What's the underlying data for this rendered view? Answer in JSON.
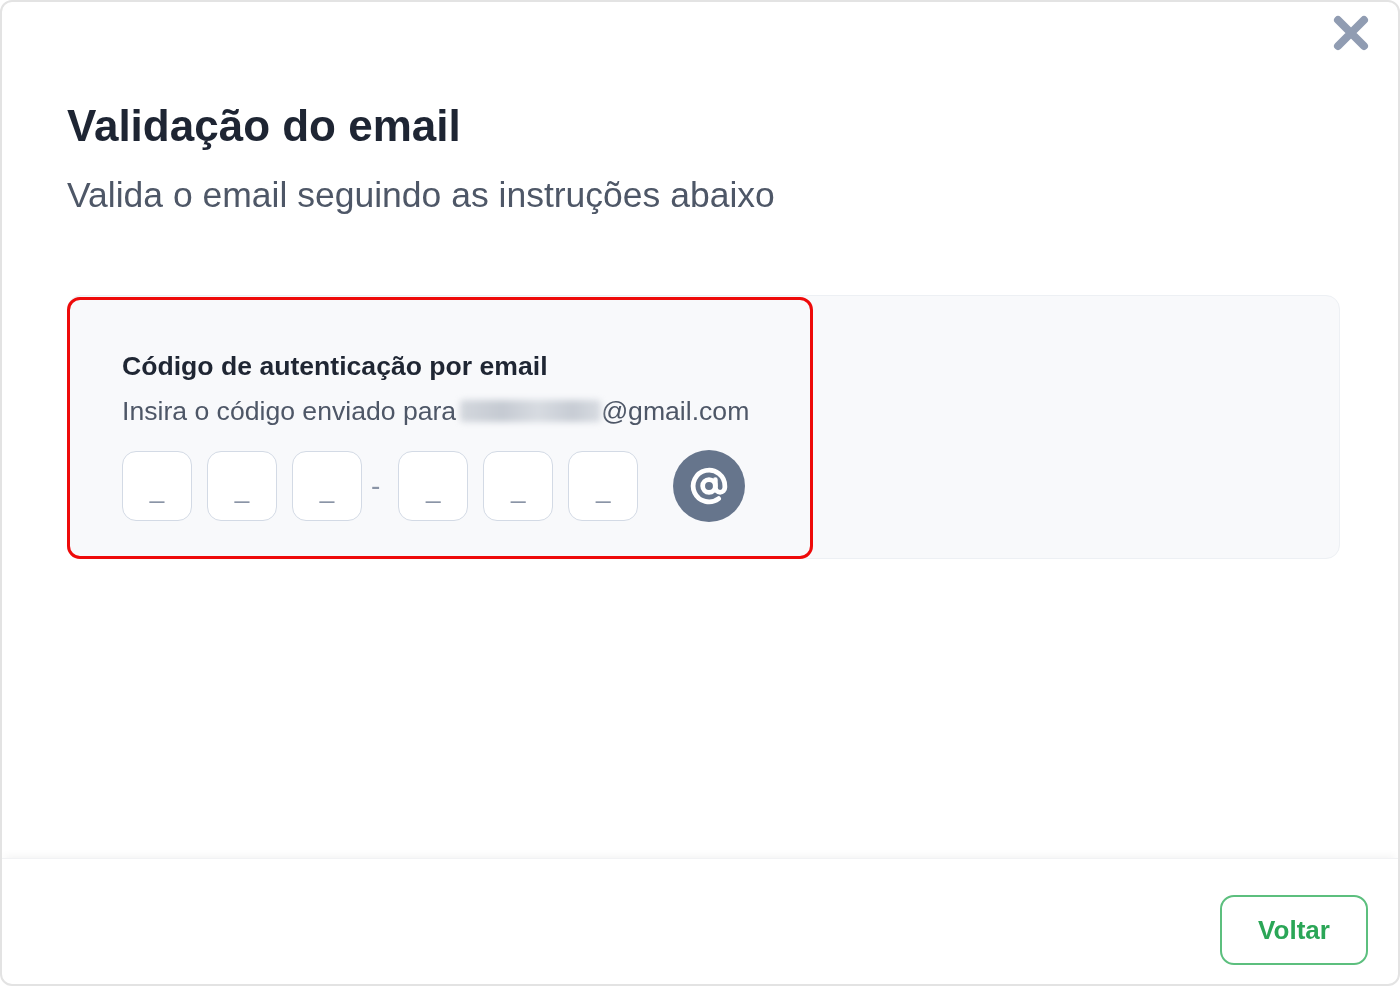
{
  "dialog": {
    "title": "Validação do email",
    "subtitle": "Valida o email seguindo as instruções abaixo"
  },
  "auth_card": {
    "highlighted": true,
    "heading": "Código de autenticação por email",
    "instruction": "Insira o código enviado para",
    "recipient": {
      "redacted": true,
      "domain": "@gmail.com"
    },
    "code_groups": [
      {
        "fields": [
          {
            "placeholder": "_"
          },
          {
            "placeholder": "_"
          },
          {
            "placeholder": "_"
          }
        ]
      },
      {
        "fields": [
          {
            "placeholder": "_"
          },
          {
            "placeholder": "_"
          },
          {
            "placeholder": "_"
          }
        ]
      }
    ],
    "separator": "-"
  },
  "footer": {
    "buttons": [
      {
        "label": "Voltar"
      }
    ]
  }
}
